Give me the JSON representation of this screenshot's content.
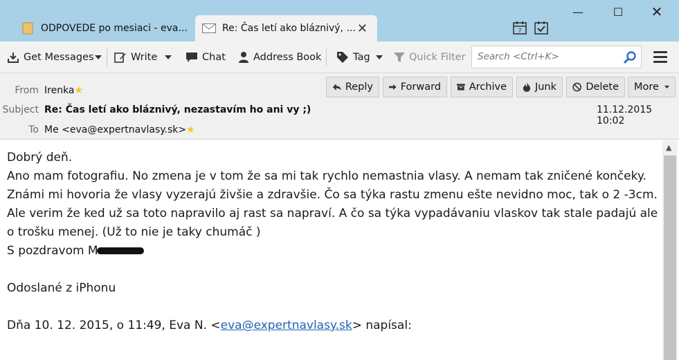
{
  "tabs": [
    {
      "label": "ODPOVEDE po mesiaci - eva...",
      "icon": "folder-icon"
    },
    {
      "label": "Re: Čas letí ako bláznivý, ...",
      "icon": "envelope-icon"
    }
  ],
  "toolbar": {
    "get_messages": "Get Messages",
    "write": "Write",
    "chat": "Chat",
    "address_book": "Address Book",
    "tag": "Tag",
    "quick_filter": "Quick Filter",
    "search_placeholder": "Search <Ctrl+K>"
  },
  "header": {
    "from_label": "From",
    "from_value": "Irenka",
    "subject_label": "Subject",
    "subject_value": "Re: Čas letí ako bláznivý, nezastavím ho ani vy ;)",
    "to_label": "To",
    "to_value": "Me <eva@expertnavlasy.sk>",
    "date": "11.12.2015 10:02",
    "buttons": {
      "reply": "Reply",
      "forward": "Forward",
      "archive": "Archive",
      "junk": "Junk",
      "delete": "Delete",
      "more": "More"
    }
  },
  "body": {
    "lines": [
      "Dobrý deň.",
      "Ano mam fotografiu. No zmena je v tom že sa mi tak rychlo nemastnia vlasy. A nemam tak zničené končeky.",
      "Známi mi hovoria že vlasy vyzerajú živšie a zdravšie. Čo sa týka rastu zmenu ešte nevidno moc, tak o 2 -3cm.",
      "Ale verim že ked už sa toto napravilo aj rast sa napraví. A čo sa týka vypadávaniu vlaskov tak stale padajú ale",
      "o trošku menej. (Už to nie je taky chumáč )"
    ],
    "signature": "S pozdravom M",
    "sent_from": "Odoslané z iPhonu",
    "quote_prefix": "Dňa 10. 12. 2015, o 11:49, Eva N. <",
    "quote_email": "eva@expertnavlasy.sk",
    "quote_suffix": "> napísal:"
  },
  "colors": {
    "tabbar": "#a8d0e6",
    "link": "#1f63b8"
  }
}
